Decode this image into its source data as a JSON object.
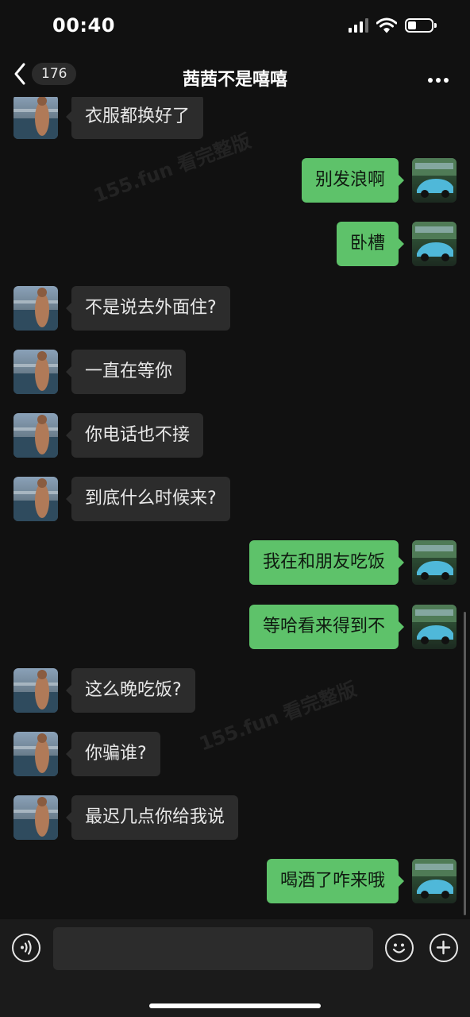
{
  "status_bar": {
    "time": "00:40",
    "battery_level": 0.35
  },
  "nav": {
    "unread_count": "176",
    "title": "茜茜不是嘻嘻"
  },
  "watermarks": [
    "155.fun 看完整版",
    "155.fun 看完整版"
  ],
  "messages": [
    {
      "side": "in",
      "text": "衣服都换好了"
    },
    {
      "side": "out",
      "text": "别发浪啊"
    },
    {
      "side": "out",
      "text": "卧槽"
    },
    {
      "side": "in",
      "text": "不是说去外面住?"
    },
    {
      "side": "in",
      "text": "一直在等你"
    },
    {
      "side": "in",
      "text": "你电话也不接"
    },
    {
      "side": "in",
      "text": "到底什么时候来?"
    },
    {
      "side": "out",
      "text": "我在和朋友吃饭"
    },
    {
      "side": "out",
      "text": "等哈看来得到不"
    },
    {
      "side": "in",
      "text": "这么晚吃饭?"
    },
    {
      "side": "in",
      "text": "你骗谁?"
    },
    {
      "side": "in",
      "text": "最迟几点你给我说"
    },
    {
      "side": "out",
      "text": "喝酒了咋来哦"
    }
  ],
  "input": {
    "placeholder": "",
    "value": ""
  },
  "icons": {
    "back": "chevron-left-icon",
    "more": "more-horizontal-icon",
    "voice": "voice-icon",
    "emoji": "emoji-icon",
    "add": "add-icon"
  },
  "colors": {
    "outgoing_bubble": "#5ec26a",
    "incoming_bubble": "#2c2c2c",
    "background": "#111111"
  }
}
